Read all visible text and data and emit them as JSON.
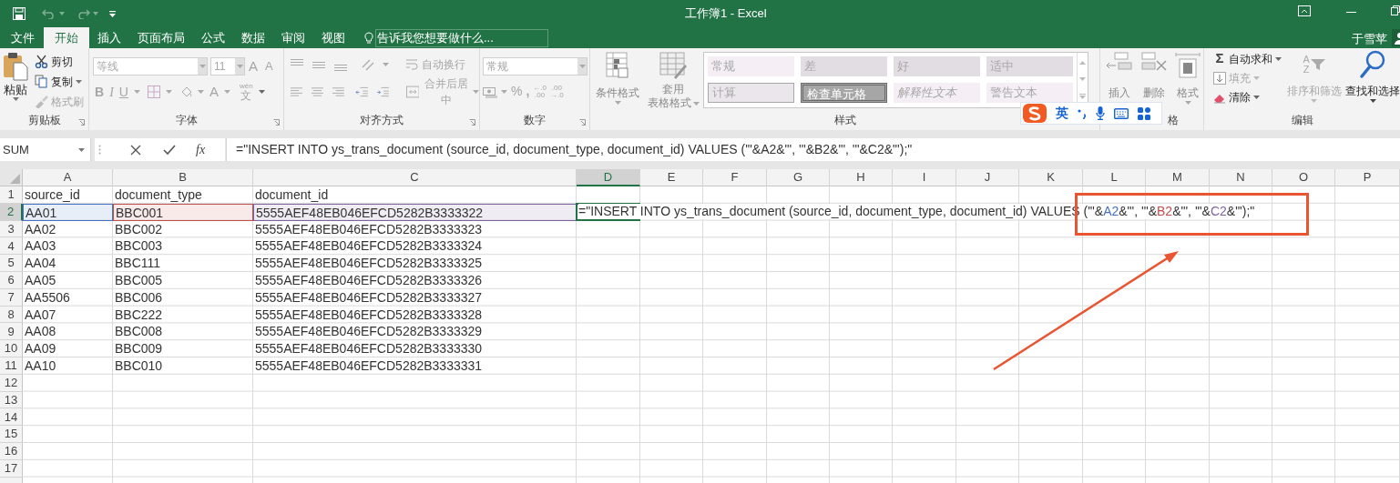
{
  "window": {
    "title": "工作簿1 - Excel"
  },
  "tabs": [
    {
      "label": "文件",
      "selected": false
    },
    {
      "label": "开始",
      "selected": true
    },
    {
      "label": "插入",
      "selected": false
    },
    {
      "label": "页面布局",
      "selected": false
    },
    {
      "label": "公式",
      "selected": false
    },
    {
      "label": "数据",
      "selected": false
    },
    {
      "label": "审阅",
      "selected": false
    },
    {
      "label": "视图",
      "selected": false
    }
  ],
  "tell_me": {
    "placeholder": "告诉我您想要做什么..."
  },
  "user": "于雪苹",
  "ribbon": {
    "clipboard": {
      "label": "剪贴板",
      "paste": "粘贴",
      "items": [
        {
          "label": "剪切",
          "disabled": false
        },
        {
          "label": "复制",
          "disabled": false
        },
        {
          "label": "格式刷",
          "disabled": true
        }
      ]
    },
    "font": {
      "label": "字体",
      "disabled": true,
      "font_name": "等线",
      "font_size": "11",
      "grow": "A",
      "shrink": "A",
      "bold": "B",
      "italic": "I",
      "underline": "U",
      "font_color": "A",
      "phonetic_ruby": "wén",
      "phonetic_base": "文"
    },
    "alignment": {
      "label": "对齐方式",
      "disabled": true,
      "wrap": "自动换行",
      "merge": "合并后居中"
    },
    "number": {
      "label": "数字",
      "disabled": true,
      "format": "常规",
      "percent": "%",
      "comma": ",",
      "decimals": [
        {
          "top": "←.0",
          "bottom": ".00"
        },
        {
          "top": ".00",
          "bottom": "→.0"
        }
      ]
    },
    "styles": {
      "label": "样式",
      "conditional": "条件格式",
      "table_format": [
        "套用",
        "表格格式"
      ],
      "gallery": [
        {
          "label": "常规",
          "kind": "normal"
        },
        {
          "label": "差",
          "kind": "bad"
        },
        {
          "label": "好",
          "kind": "good"
        },
        {
          "label": "适中",
          "kind": "neutral"
        },
        {
          "label": "计算",
          "kind": "calculation"
        },
        {
          "label": "检查单元格",
          "kind": "check"
        },
        {
          "label": "解释性文本",
          "kind": "explanatory"
        },
        {
          "label": "警告文本",
          "kind": "warning"
        }
      ]
    },
    "cells": {
      "label": "格",
      "buttons": [
        "插入",
        "删除",
        "格式"
      ]
    },
    "editing": {
      "label": "编辑",
      "sum_symbol": "Σ",
      "items": [
        {
          "label": "自动求和",
          "disabled": false
        },
        {
          "label": "填充",
          "disabled": true
        },
        {
          "label": "清除",
          "disabled": false
        }
      ],
      "sort": {
        "label": "排序和筛选",
        "letters": [
          "A",
          "Z"
        ],
        "disabled": true
      },
      "find": {
        "label": "查找和选择",
        "disabled": false
      }
    }
  },
  "ime_bar": {
    "mode": "英"
  },
  "formula_bar": {
    "name_box": "SUM",
    "function_label": "fx",
    "formula": "=\"INSERT INTO ys_trans_document (source_id, document_type, document_id) VALUES ('\"&A2&\"', '\"&B2&\"', '\"&C2&\"');\""
  },
  "columns": [
    {
      "label": "A",
      "selected": false
    },
    {
      "label": "B",
      "selected": false
    },
    {
      "label": "C",
      "selected": false
    },
    {
      "label": "D",
      "selected": true
    },
    {
      "label": "E",
      "selected": false
    },
    {
      "label": "F",
      "selected": false
    },
    {
      "label": "G",
      "selected": false
    },
    {
      "label": "H",
      "selected": false
    },
    {
      "label": "I",
      "selected": false
    },
    {
      "label": "J",
      "selected": false
    },
    {
      "label": "K",
      "selected": false
    },
    {
      "label": "L",
      "selected": false
    },
    {
      "label": "M",
      "selected": false
    },
    {
      "label": "N",
      "selected": false
    },
    {
      "label": "O",
      "selected": false
    },
    {
      "label": "P",
      "selected": false
    }
  ],
  "rows": [
    {
      "label": "1",
      "selected": false,
      "cells": [
        {
          "text": "source_id"
        },
        {
          "text": "document_type"
        },
        {
          "text": "document_id"
        }
      ]
    },
    {
      "label": "2",
      "selected": true,
      "cells": [
        {
          "text": "AA01",
          "color": "#4472c4"
        },
        {
          "text": "BBC001",
          "color": "#c0504d"
        },
        {
          "text": "5555AEF48EB046EFCD5282B3333322",
          "color": "#8064a2"
        }
      ],
      "edit_formula": [
        {
          "text": "=\"INSERT INTO ys_trans_document (source_id, document_type, document_id) VALUES ('\"&"
        },
        {
          "text": "A2",
          "color": "#4472c4"
        },
        {
          "text": "&\"', '\"&"
        },
        {
          "text": "B2",
          "color": "#c0504d"
        },
        {
          "text": "&\"', '\"&"
        },
        {
          "text": "C2",
          "color": "#8064a2"
        },
        {
          "text": "&\"');\""
        }
      ]
    },
    {
      "label": "3",
      "selected": false,
      "cells": [
        {
          "text": "AA02"
        },
        {
          "text": "BBC002"
        },
        {
          "text": "5555AEF48EB046EFCD5282B3333323"
        }
      ]
    },
    {
      "label": "4",
      "selected": false,
      "cells": [
        {
          "text": "AA03"
        },
        {
          "text": "BBC003"
        },
        {
          "text": "5555AEF48EB046EFCD5282B3333324"
        }
      ]
    },
    {
      "label": "5",
      "selected": false,
      "cells": [
        {
          "text": "AA04"
        },
        {
          "text": "BBC111"
        },
        {
          "text": "5555AEF48EB046EFCD5282B3333325"
        }
      ]
    },
    {
      "label": "6",
      "selected": false,
      "cells": [
        {
          "text": "AA05"
        },
        {
          "text": "BBC005"
        },
        {
          "text": "5555AEF48EB046EFCD5282B3333326"
        }
      ]
    },
    {
      "label": "7",
      "selected": false,
      "cells": [
        {
          "text": "AA5506"
        },
        {
          "text": "BBC006"
        },
        {
          "text": "5555AEF48EB046EFCD5282B3333327"
        }
      ]
    },
    {
      "label": "8",
      "selected": false,
      "cells": [
        {
          "text": "AA07"
        },
        {
          "text": "BBC222"
        },
        {
          "text": "5555AEF48EB046EFCD5282B3333328"
        }
      ]
    },
    {
      "label": "9",
      "selected": false,
      "cells": [
        {
          "text": "AA08"
        },
        {
          "text": "BBC008"
        },
        {
          "text": "5555AEF48EB046EFCD5282B3333329"
        }
      ]
    },
    {
      "label": "10",
      "selected": false,
      "cells": [
        {
          "text": "AA09"
        },
        {
          "text": "BBC009"
        },
        {
          "text": "5555AEF48EB046EFCD5282B3333330"
        }
      ]
    },
    {
      "label": "11",
      "selected": false,
      "cells": [
        {
          "text": "AA10"
        },
        {
          "text": "BBC010"
        },
        {
          "text": "5555AEF48EB046EFCD5282B3333331"
        }
      ]
    },
    {
      "label": "12",
      "selected": false,
      "cells": []
    },
    {
      "label": "13",
      "selected": false,
      "cells": []
    },
    {
      "label": "14",
      "selected": false,
      "cells": []
    },
    {
      "label": "15",
      "selected": false,
      "cells": []
    },
    {
      "label": "16",
      "selected": false,
      "cells": []
    },
    {
      "label": "17",
      "selected": false,
      "cells": []
    }
  ]
}
